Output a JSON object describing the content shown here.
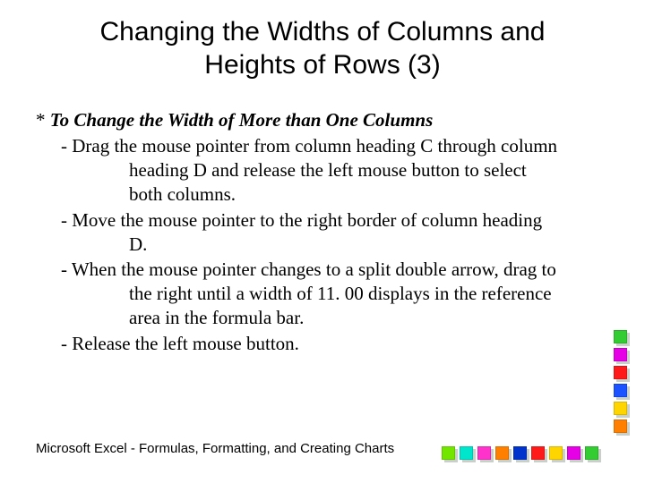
{
  "title": "Changing the Widths of Columns and Heights of Rows (3)",
  "asterisk": "* ",
  "lead": "To Change the Width of More than One Columns",
  "bullets": [
    "- Drag the mouse pointer  from column heading C through column heading D and release the left mouse button to select both columns.",
    "- Move the mouse pointer to the right border of column heading D.",
    "- When the mouse pointer changes to a split double arrow, drag to the right until a width of 11. 00 displays in the reference area in the formula bar.",
    "- Release the left mouse button."
  ],
  "footer": "Microsoft  Excel - Formulas, Formatting, and Creating Charts",
  "deco_right": [
    "c-green",
    "c-magenta",
    "c-red",
    "c-blue",
    "c-yellow",
    "c-orange"
  ],
  "deco_bottom": [
    "c-lime",
    "c-cyan",
    "c-pink",
    "c-orange",
    "c-dblue",
    "c-red",
    "c-yellow",
    "c-magenta",
    "c-green"
  ]
}
